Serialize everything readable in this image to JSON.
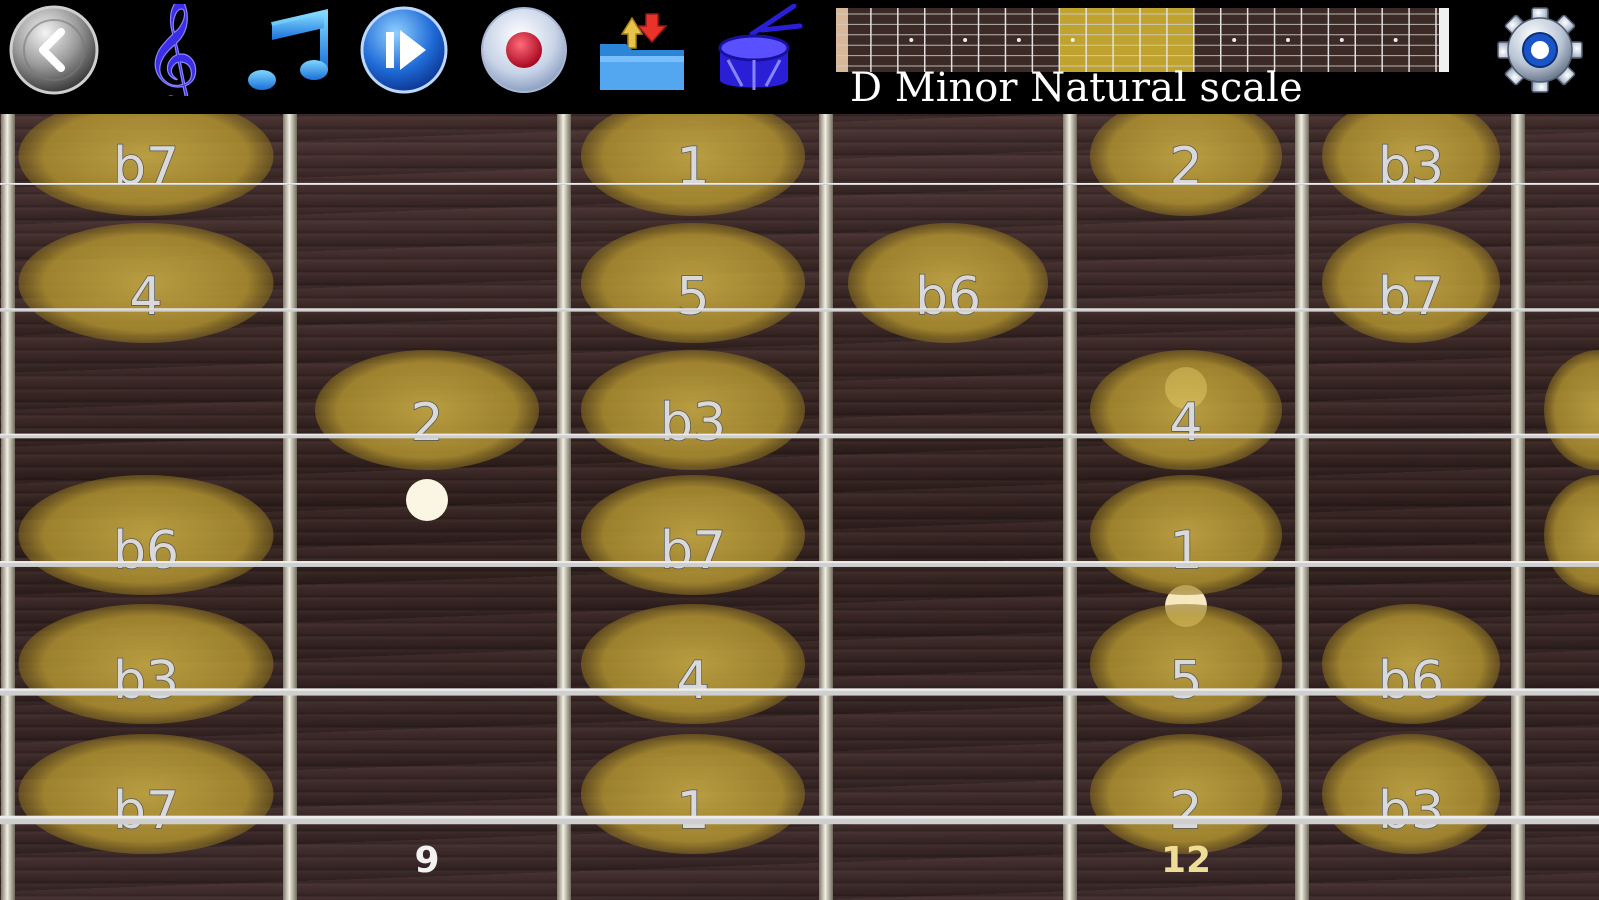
{
  "app": {
    "scale_title": "D Minor Natural scale",
    "colors": {
      "background": "#000000",
      "note_highlight": "#bfa23a",
      "fretboard_wood": "#3a2628",
      "fret_wire": "#c9c5b6",
      "accent_blue": "#2233dd",
      "mini_highlight": "#d8b830"
    }
  },
  "toolbar": {
    "buttons": [
      {
        "name": "back-button",
        "icon": "back-arrow-icon"
      },
      {
        "name": "scale-select-button",
        "icon": "treble-clef-icon"
      },
      {
        "name": "notes-button",
        "icon": "music-note-icon"
      },
      {
        "name": "play-button",
        "icon": "play-icon"
      },
      {
        "name": "record-button",
        "icon": "record-icon"
      },
      {
        "name": "file-button",
        "icon": "folder-icon"
      },
      {
        "name": "drum-button",
        "icon": "drum-icon"
      },
      {
        "name": "settings-button",
        "icon": "gear-icon"
      }
    ]
  },
  "mini_fretboard": {
    "highlight_start_fret": 8,
    "highlight_end_fret": 13,
    "total_frets": 22
  },
  "fretboard": {
    "visible_fret_numbers": [
      {
        "fret_index": 1,
        "label": "9",
        "color": "#f2f2f2"
      },
      {
        "fret_index": 4,
        "label": "12",
        "color": "#eedd99"
      }
    ],
    "strings": [
      [
        "b7",
        "",
        "1",
        "",
        "2",
        "b3"
      ],
      [
        "4",
        "",
        "5",
        "b6",
        "",
        "b7"
      ],
      [
        "",
        "2",
        "b3",
        "",
        "4",
        ""
      ],
      [
        "b6",
        "",
        "b7",
        "",
        "1",
        ""
      ],
      [
        "b3",
        "",
        "4",
        "",
        "5",
        "b6"
      ],
      [
        "b7",
        "",
        "1",
        "",
        "2",
        "b3"
      ]
    ],
    "notes": [
      {
        "label": "b7",
        "string": 0,
        "fret": 0
      },
      {
        "label": "1",
        "string": 0,
        "fret": 2
      },
      {
        "label": "2",
        "string": 0,
        "fret": 4
      },
      {
        "label": "b3",
        "string": 0,
        "fret": 5
      },
      {
        "label": "4",
        "string": 1,
        "fret": 0
      },
      {
        "label": "5",
        "string": 1,
        "fret": 2
      },
      {
        "label": "b6",
        "string": 1,
        "fret": 3
      },
      {
        "label": "b7",
        "string": 1,
        "fret": 5
      },
      {
        "label": "2",
        "string": 2,
        "fret": 1
      },
      {
        "label": "b3",
        "string": 2,
        "fret": 2
      },
      {
        "label": "4",
        "string": 2,
        "fret": 4
      },
      {
        "label": "b6",
        "string": 3,
        "fret": 0
      },
      {
        "label": "b7",
        "string": 3,
        "fret": 2
      },
      {
        "label": "1",
        "string": 3,
        "fret": 4
      },
      {
        "label": "b3",
        "string": 4,
        "fret": 0
      },
      {
        "label": "4",
        "string": 4,
        "fret": 2
      },
      {
        "label": "5",
        "string": 4,
        "fret": 4
      },
      {
        "label": "b6",
        "string": 4,
        "fret": 5
      },
      {
        "label": "b7",
        "string": 5,
        "fret": 0
      },
      {
        "label": "1",
        "string": 5,
        "fret": 2
      },
      {
        "label": "2",
        "string": 5,
        "fret": 4
      },
      {
        "label": "b3",
        "string": 5,
        "fret": 5
      }
    ]
  }
}
